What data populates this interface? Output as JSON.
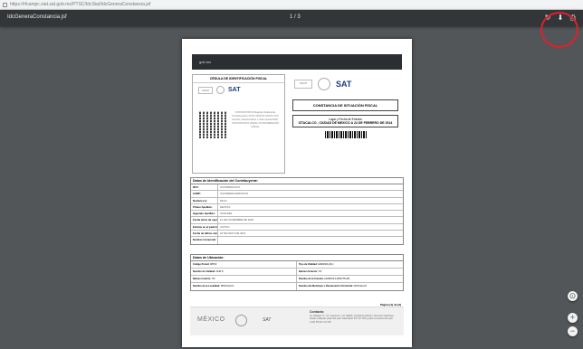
{
  "browser": {
    "url": "https://rfcampc.siat.sat.gob.mx/PTSC/IdcSiat/IdcGeneraConstancia.jsf"
  },
  "viewer": {
    "file_name": "IdcGeneraConstancia.jsf",
    "page_counter": "1 / 3"
  },
  "document": {
    "gob_banner": "gob.mx",
    "cedula_title": "CÉDULA DE IDENTIFICACIÓN FISCAL",
    "shcp": "SHCP",
    "sat": "SAT",
    "cedula_text": "XXXXXXXXXXXX Registro Federal de Contribuyentes XXXX XXXXXX XXXXX XXX Nombre, denominación o razón social IdCIF: XXXXXXXXXXX VALIDA TU INFORMACIÓN FISCAL",
    "constancia_title": "CONSTANCIA DE SITUACIÓN FISCAL",
    "lugar_label": "Lugar y Fecha de Emisión",
    "lugar_value": "IZTACALCO , CIUDAD DE MEXICO A 24 DE FEBRERO DE 2014",
    "ident_title": "Datos de Identificación del Contribuyente:",
    "ident_rows": [
      {
        "k": "RFC:",
        "v": "XXXX990101XXX"
      },
      {
        "k": "CURP:",
        "v": "XXXX990101HDFXXX01"
      },
      {
        "k": "Nombre (s):",
        "v": "PAULI"
      },
      {
        "k": "Primer Apellido:",
        "v": "DEXXXX"
      },
      {
        "k": "Segundo Apellido:",
        "v": "SANCHEZ"
      },
      {
        "k": "Fecha inicio de operaciones:",
        "v": "12 DE NOVIEMBRE DE 2004"
      },
      {
        "k": "Estatus en el padrón:",
        "v": "ACTIVO"
      },
      {
        "k": "Fecha de último cambio de estado:",
        "v": "18 DE MAYO DE 2013"
      },
      {
        "k": "Nombre Comercial:",
        "v": ""
      }
    ],
    "ubic_title": "Datos de Ubicación:",
    "ubic_rows": [
      {
        "k1": "Código Postal:",
        "v1": "08700",
        "k2": "Tipo de Vialidad:",
        "v2": "AVENIDA (AV.)"
      },
      {
        "k1": "Nombre de Vialidad:",
        "v1": "SUR 8",
        "k2": "Número Exterior:",
        "v2": "XX"
      },
      {
        "k1": "Número Interior:",
        "v1": "XX",
        "k2": "Nombre de la Colonia:",
        "v2": "AGRICOLA PANTITLAN"
      },
      {
        "k1": "Nombre de la Localidad:",
        "v1": "IZTACALCO",
        "k2": "Nombre del Municipio o Demarcación Territorial:",
        "v2": "IZTACALCO"
      }
    ],
    "pagina": "Página [1] de [3]",
    "footer_mexico": "MÉXICO",
    "footer_sat": "SAT",
    "contact_title": "Contacto:",
    "contact_text": "Av. Hidalgo 77, col. Guerrero, C.P. 06300, Ciudad de México. Atención telefónica desde cualquier parte del país: MarcaSAT 627 22 728 y para el exterior del país (+52) 55 627 22 728"
  },
  "icons": {
    "rotate": "rotate-icon",
    "download": "download-icon",
    "print": "print-icon",
    "fit": "fit-page-icon",
    "zoom_in": "zoom-in-icon",
    "zoom_out": "zoom-out-icon"
  },
  "colors": {
    "highlight": "#e0202a",
    "viewer_bg": "#525659",
    "toolbar_bg": "#323639"
  }
}
